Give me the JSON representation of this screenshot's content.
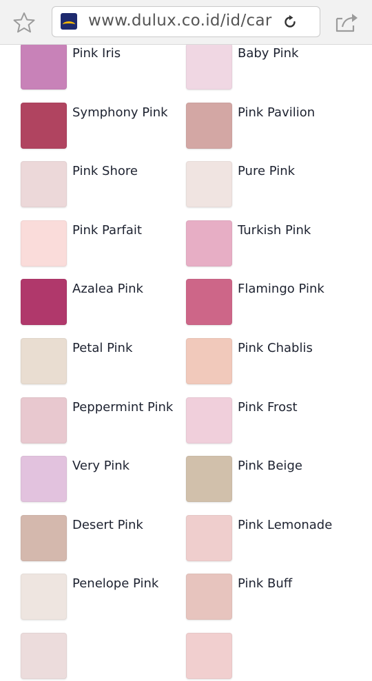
{
  "browser": {
    "url": "www.dulux.co.id/id/car",
    "bookmark_icon": "star-icon",
    "reload_icon": "reload-icon",
    "share_icon": "share-icon"
  },
  "colors": [
    {
      "name": "Pink Iris",
      "hex": "#c882b8"
    },
    {
      "name": "Baby Pink",
      "hex": "#f0d7e3"
    },
    {
      "name": "Symphony Pink",
      "hex": "#b04460"
    },
    {
      "name": "Pink Pavilion",
      "hex": "#d3a7a4"
    },
    {
      "name": "Pink Shore",
      "hex": "#ecd8d9"
    },
    {
      "name": "Pure Pink",
      "hex": "#f0e4e1"
    },
    {
      "name": "Pink Parfait",
      "hex": "#fadcda"
    },
    {
      "name": "Turkish Pink",
      "hex": "#e7aec5"
    },
    {
      "name": "Azalea Pink",
      "hex": "#b0386b"
    },
    {
      "name": "Flamingo Pink",
      "hex": "#cd6688"
    },
    {
      "name": "Petal Pink",
      "hex": "#e9ddd1"
    },
    {
      "name": "Pink Chablis",
      "hex": "#f1c9bb"
    },
    {
      "name": "Peppermint Pink",
      "hex": "#e8c8cf"
    },
    {
      "name": "Pink Frost",
      "hex": "#f0cfdb"
    },
    {
      "name": "Very Pink",
      "hex": "#e2c2de"
    },
    {
      "name": "Pink Beige",
      "hex": "#d1c0ab"
    },
    {
      "name": "Desert Pink",
      "hex": "#d4b8ad"
    },
    {
      "name": "Pink Lemonade",
      "hex": "#efcecd"
    },
    {
      "name": "Penelope Pink",
      "hex": "#eee5e0"
    },
    {
      "name": "Pink Buff",
      "hex": "#e7c4be"
    },
    {
      "name": "",
      "hex": "#ecdcdc"
    },
    {
      "name": "",
      "hex": "#f1cfcf"
    }
  ]
}
